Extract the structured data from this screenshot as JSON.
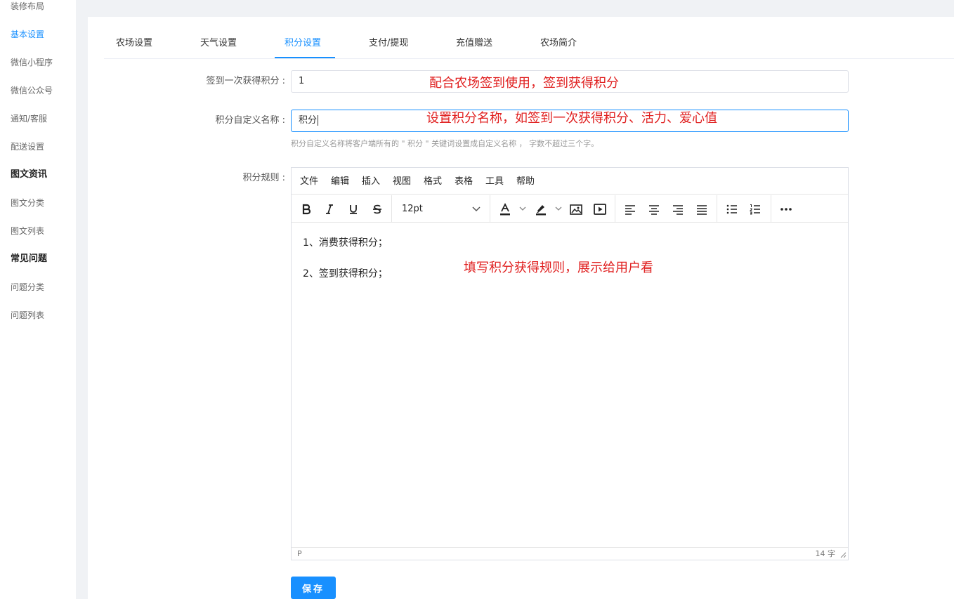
{
  "sidebar": {
    "items": [
      {
        "label": "装修布局"
      },
      {
        "label": "基本设置"
      },
      {
        "label": "微信小程序"
      },
      {
        "label": "微信公众号"
      },
      {
        "label": "通知/客服"
      },
      {
        "label": "配送设置"
      }
    ],
    "group_news": "图文资讯",
    "news_items": [
      {
        "label": "图文分类"
      },
      {
        "label": "图文列表"
      }
    ],
    "group_faq": "常见问题",
    "faq_items": [
      {
        "label": "问题分类"
      },
      {
        "label": "问题列表"
      }
    ],
    "active_color": "#1890ff"
  },
  "tabs": [
    {
      "label": "农场设置"
    },
    {
      "label": "天气设置"
    },
    {
      "label": "积分设置"
    },
    {
      "label": "支付/提现"
    },
    {
      "label": "充值赠送"
    },
    {
      "label": "农场简介"
    }
  ],
  "active_tab": "积分设置",
  "form": {
    "signin_label": "签到一次获得积分 :",
    "signin_value": "1",
    "custom_name_label": "积分自定义名称 :",
    "custom_name_value": "积分",
    "custom_name_hint": "积分自定义名称将客户端所有的 \" 积分 \" 关键词设置成自定义名称 ， 字数不超过三个字。",
    "rules_label": "积分规则 :"
  },
  "annotations": {
    "a1": "配合农场签到使用，签到获得积分",
    "a2": "设置积分名称，如签到一次获得积分、活力、爱心值",
    "a3": "填写积分获得规则，展示给用户看",
    "color": "#e02020"
  },
  "editor": {
    "menu": [
      "文件",
      "编辑",
      "插入",
      "视图",
      "格式",
      "表格",
      "工具",
      "帮助"
    ],
    "font_size": "12pt",
    "toolbar_icons": [
      "bold-icon",
      "italic-icon",
      "underline-icon",
      "strikethrough-icon",
      "font-size-select",
      "text-color-icon",
      "highlight-icon",
      "image-icon",
      "video-icon",
      "align-left-icon",
      "align-center-icon",
      "align-right-icon",
      "justify-icon",
      "bullet-list-icon",
      "numbered-list-icon",
      "more-icon"
    ],
    "content": [
      "1、消费获得积分；",
      "2、签到获得积分；"
    ],
    "status_path": "P",
    "word_count": "14 字"
  },
  "save_label": "保存",
  "primary_color": "#1890ff"
}
